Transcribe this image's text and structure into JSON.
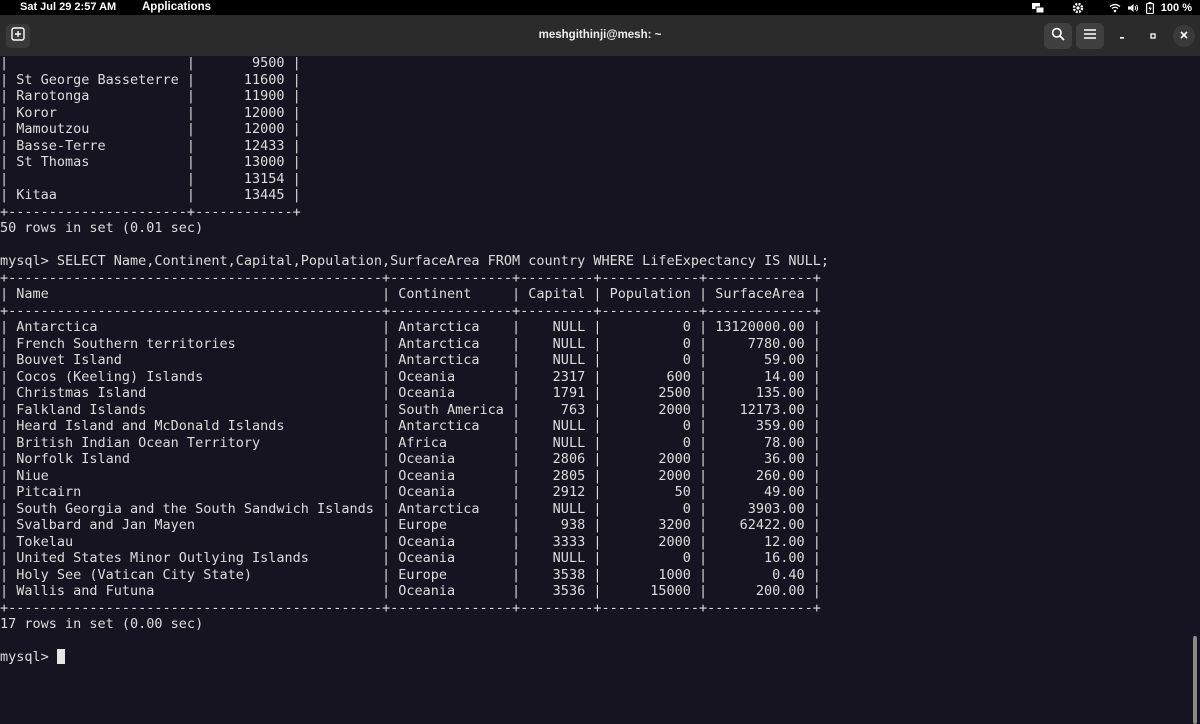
{
  "top_bar": {
    "clock": "Sat Jul 29  2:57 AM",
    "applications_label": "Applications",
    "battery_percent": "100 %"
  },
  "title_bar": {
    "title": "meshgithinji@mesh: ~"
  },
  "terminal": {
    "lines": [
      "|                      |       9500 |",
      "| St George Basseterre |      11600 |",
      "| Rarotonga            |      11900 |",
      "| Koror                |      12000 |",
      "| Mamoutzou            |      12000 |",
      "| Basse-Terre          |      12433 |",
      "| St Thomas            |      13000 |",
      "|                      |      13154 |",
      "| Kitaa                |      13445 |",
      "+----------------------+------------+",
      "50 rows in set (0.01 sec)",
      "",
      "mysql> SELECT Name,Continent,Capital,Population,SurfaceArea FROM country WHERE LifeExpectancy IS NULL;",
      "+----------------------------------------------+---------------+---------+------------+-------------+",
      "| Name                                         | Continent     | Capital | Population | SurfaceArea |",
      "+----------------------------------------------+---------------+---------+------------+-------------+",
      "| Antarctica                                   | Antarctica    |    NULL |          0 | 13120000.00 |",
      "| French Southern territories                  | Antarctica    |    NULL |          0 |     7780.00 |",
      "| Bouvet Island                                | Antarctica    |    NULL |          0 |       59.00 |",
      "| Cocos (Keeling) Islands                      | Oceania       |    2317 |        600 |       14.00 |",
      "| Christmas Island                             | Oceania       |    1791 |       2500 |      135.00 |",
      "| Falkland Islands                             | South America |     763 |       2000 |    12173.00 |",
      "| Heard Island and McDonald Islands            | Antarctica    |    NULL |          0 |      359.00 |",
      "| British Indian Ocean Territory               | Africa        |    NULL |          0 |       78.00 |",
      "| Norfolk Island                               | Oceania       |    2806 |       2000 |       36.00 |",
      "| Niue                                         | Oceania       |    2805 |       2000 |      260.00 |",
      "| Pitcairn                                     | Oceania       |    2912 |         50 |       49.00 |",
      "| South Georgia and the South Sandwich Islands | Antarctica    |    NULL |          0 |     3903.00 |",
      "| Svalbard and Jan Mayen                       | Europe        |     938 |       3200 |    62422.00 |",
      "| Tokelau                                      | Oceania       |    3333 |       2000 |       12.00 |",
      "| United States Minor Outlying Islands         | Oceania       |    NULL |          0 |       16.00 |",
      "| Holy See (Vatican City State)                | Europe        |    3538 |       1000 |        0.40 |",
      "| Wallis and Futuna                            | Oceania       |    3536 |      15000 |      200.00 |",
      "+----------------------------------------------+---------------+---------+------------+-------------+",
      "17 rows in set (0.00 sec)",
      ""
    ],
    "prompt": "mysql> "
  },
  "colors": {
    "terminal_bg": "#171421",
    "terminal_fg": "#dcdcdc",
    "titlebar_bg": "#2b2b2b",
    "topbar_bg": "#000000"
  },
  "icons": {
    "new_tab": "new-tab-icon",
    "search": "search-icon",
    "menu": "hamburger-icon",
    "minimize": "minimize-icon",
    "maximize": "maximize-icon",
    "close": "close-icon",
    "network": "network-icon",
    "settings": "gear-icon",
    "wifi": "wifi-icon",
    "volume": "volume-icon",
    "battery": "battery-icon"
  }
}
